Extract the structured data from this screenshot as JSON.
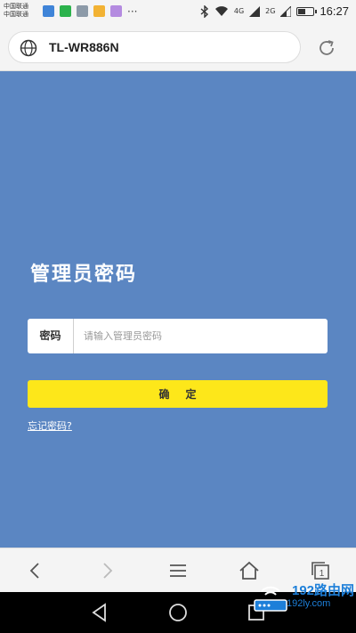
{
  "status_bar": {
    "carrier_lines": [
      "中国联通",
      "中国联通"
    ],
    "network_labels": [
      "4G",
      "2G"
    ],
    "battery_level": 0.55,
    "time": "16:27",
    "more_icon": "···"
  },
  "browser": {
    "url": "TL-WR886N",
    "icons": {
      "site": "globe-icon",
      "reload": "reload-icon"
    }
  },
  "page": {
    "title": "管理员密码",
    "password_label": "密码",
    "password_placeholder": "请输入管理员密码",
    "password_value": "",
    "ok_label": "确定",
    "forgot_link": "忘记密码?",
    "background_color": "#5b86c2",
    "button_color": "#fde71a"
  },
  "toolbar": {
    "icons": [
      "back-icon",
      "forward-icon",
      "menu-icon",
      "home-icon",
      "tabs-icon"
    ],
    "tab_count": "1"
  },
  "navbar": {
    "icons": [
      "nav-back-icon",
      "nav-home-icon",
      "nav-recent-icon"
    ]
  },
  "watermark": {
    "big_text": "192路由网",
    "small_text": "192ly.com"
  }
}
